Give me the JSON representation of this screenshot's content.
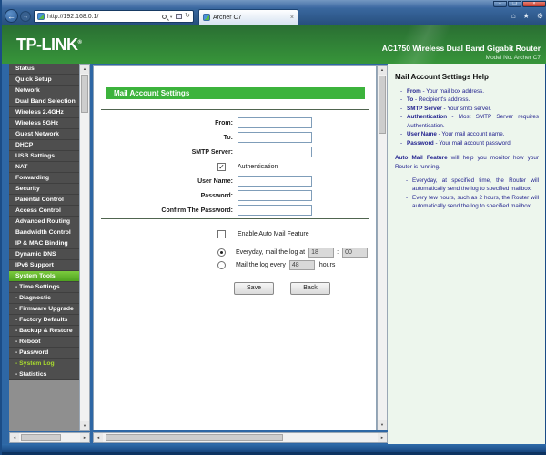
{
  "window": {
    "minimize": "−",
    "restore": "❐",
    "close": "×"
  },
  "browser": {
    "url": "http://192.168.0.1/",
    "tab_title": "Archer C7",
    "icons": {
      "back": "←",
      "forward": "→",
      "dropdown": "▼",
      "refresh": "↻",
      "tab_close": "×",
      "home": "⌂",
      "favorites": "★",
      "tools": "⚙"
    }
  },
  "banner": {
    "logo": "TP-LINK",
    "logo_reg": "®",
    "product": "AC1750 Wireless Dual Band Gigabit Router",
    "model": "Model No. Archer C7"
  },
  "sidebar": {
    "items": [
      {
        "label": "Status"
      },
      {
        "label": "Quick Setup"
      },
      {
        "label": "Network"
      },
      {
        "label": "Dual Band Selection"
      },
      {
        "label": "Wireless 2.4GHz"
      },
      {
        "label": "Wireless 5GHz"
      },
      {
        "label": "Guest Network"
      },
      {
        "label": "DHCP"
      },
      {
        "label": "USB Settings"
      },
      {
        "label": "NAT"
      },
      {
        "label": "Forwarding"
      },
      {
        "label": "Security"
      },
      {
        "label": "Parental Control"
      },
      {
        "label": "Access Control"
      },
      {
        "label": "Advanced Routing"
      },
      {
        "label": "Bandwidth Control"
      },
      {
        "label": "IP & MAC Binding"
      },
      {
        "label": "Dynamic DNS"
      },
      {
        "label": "IPv6 Support"
      },
      {
        "label": "System Tools",
        "state": "active"
      },
      {
        "label": "- Time Settings",
        "sub": true
      },
      {
        "label": "- Diagnostic",
        "sub": true
      },
      {
        "label": "- Firmware Upgrade",
        "sub": true
      },
      {
        "label": "- Factory Defaults",
        "sub": true
      },
      {
        "label": "- Backup & Restore",
        "sub": true
      },
      {
        "label": "- Reboot",
        "sub": true
      },
      {
        "label": "- Password",
        "sub": true
      },
      {
        "label": "- System Log",
        "sub": true,
        "state": "active-sub"
      },
      {
        "label": "- Statistics",
        "sub": true
      }
    ]
  },
  "main": {
    "title": "Mail Account Settings",
    "from_label": "From:",
    "to_label": "To:",
    "smtp_label": "SMTP Server:",
    "auth_label": "Authentication",
    "auth_checked": "✓",
    "username_label": "User Name:",
    "password_label": "Password:",
    "confirm_label": "Confirm The Password:",
    "enable_auto_mail_label": "Enable Auto Mail Feature",
    "radio_everyday_text": "Everyday, mail the log at",
    "hour_value": "18",
    "colon": ":",
    "minute_value": "00",
    "radio_every_text": "Mail the log every",
    "hours_value": "48",
    "hours_suffix": "hours",
    "save_label": "Save",
    "back_label": "Back"
  },
  "help": {
    "title": "Mail Account Settings Help",
    "bullets": [
      {
        "term": "From",
        "desc": " - Your mail box address."
      },
      {
        "term": "To",
        "desc": " - Recipient's address."
      },
      {
        "term": "SMTP Server",
        "desc": " - Your smtp server."
      },
      {
        "term": "Authentication",
        "desc": " - Most SMTP Server requires Authentication."
      },
      {
        "term": "User Name",
        "desc": " - Your mail account name."
      },
      {
        "term": "Password",
        "desc": " - Your mail account password."
      }
    ],
    "paragraph_term": "Auto Mail Feature",
    "paragraph_rest": " will help you monitor how your Router is running.",
    "bullets2": [
      "Everyday, at specified time, the Router will automatically send the log to specified mailbox.",
      "Every few hours, such as 2 hours, the Router will automatically send the log to specified mailbox."
    ]
  },
  "scroll_icons": {
    "up": "▲",
    "down": "▼",
    "left": "◄",
    "right": "►"
  },
  "colors": {
    "banner_green_top": "#2a6f33",
    "banner_green_bottom": "#37953a",
    "section_title_green": "#3cb33c",
    "sidebar_bg": "#4e4e4e",
    "sidebar_active_green": "#5fb52c",
    "sidebar_active_sub_text": "#a8da2e",
    "help_bg": "#edf6ed",
    "help_text_navy": "#23238f",
    "chrome_blue": "#2e67a5",
    "disabled_input_bg": "#d9d9d9"
  }
}
